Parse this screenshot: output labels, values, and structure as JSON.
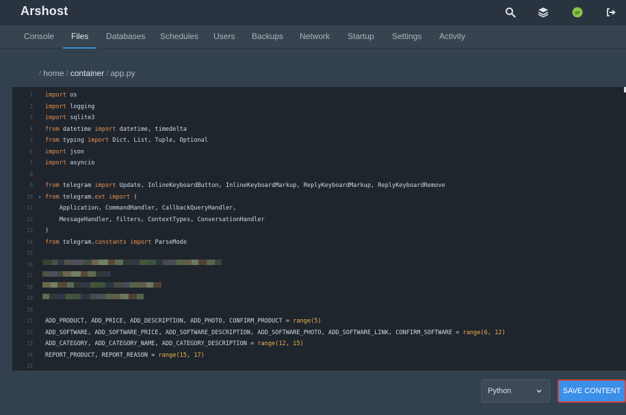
{
  "app": {
    "title": "Arshost"
  },
  "header": {
    "icons": [
      "search-icon",
      "layers-icon",
      "user-avatar",
      "logout-icon"
    ],
    "avatar_color": "#8bc34a"
  },
  "nav": {
    "tabs": [
      {
        "label": "Console"
      },
      {
        "label": "Files",
        "active": true
      },
      {
        "label": "Databases"
      },
      {
        "label": "Schedules"
      },
      {
        "label": "Users"
      },
      {
        "label": "Backups"
      },
      {
        "label": "Network"
      },
      {
        "label": "Startup"
      },
      {
        "label": "Settings"
      },
      {
        "label": "Activity"
      }
    ]
  },
  "breadcrumb": {
    "sep": "/",
    "segments": [
      "home",
      "container",
      "app.py"
    ]
  },
  "editor": {
    "lines": [
      "import os",
      "import logging",
      "import sqlite3",
      "from datetime import datetime, timedelta",
      "from typing import Dict, List, Tuple, Optional",
      "import json",
      "import asyncio",
      "",
      "from telegram import Update, InlineKeyboardButton, InlineKeyboardMarkup, ReplyKeyboardMarkup, ReplyKeyboardRemove",
      "from telegram.ext import (",
      "    Application, CommandHandler, CallbackQueryHandler,",
      "    MessageHandler, filters, ContextTypes, ConversationHandler",
      ")",
      "from telegram.constants import ParseMode",
      "",
      "",
      "",
      "",
      "",
      "",
      "ADD_PRODUCT, ADD_PRICE, ADD_DESCRIPTION, ADD_PHOTO, CONFIRM_PRODUCT = range(5)",
      "ADD_SOFTWARE, ADD_SOFTWARE_PRICE, ADD_SOFTWARE_DESCRIPTION, ADD_SOFTWARE_PHOTO, ADD_SOFTWARE_LINK, CONFIRM_SOFTWARE = range(6, 12)",
      "ADD_CATEGORY, ADD_CATEGORY_NAME, ADD_CATEGORY_DESCRIPTION = range(12, 15)",
      "REPORT_PRODUCT, REPORT_REASON = range(15, 17)",
      ""
    ],
    "fold_lines": [
      10
    ]
  },
  "footer": {
    "language_label": "Python",
    "save_label": "SAVE CONTENT"
  }
}
